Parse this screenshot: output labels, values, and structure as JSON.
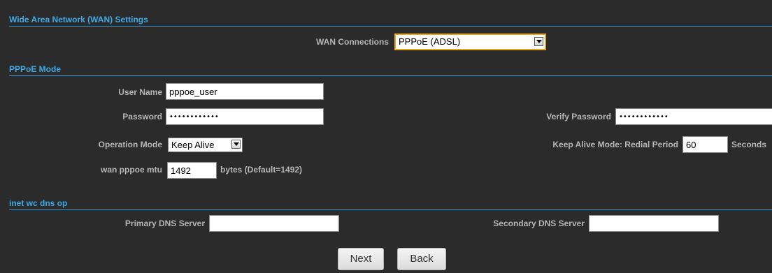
{
  "wan": {
    "title": "Wide Area Network (WAN) Settings",
    "connections_label": "WAN Connections",
    "connections_value": "PPPoE (ADSL)"
  },
  "pppoe": {
    "title": "PPPoE Mode",
    "username_label": "User Name",
    "username_value": "pppoe_user",
    "password_label": "Password",
    "password_value": "xxxxxxxxxxxx",
    "verify_label": "Verify Password",
    "verify_value": "xxxxxxxxxxxx",
    "opmode_label": "Operation Mode",
    "opmode_value": "Keep Alive",
    "redial_label": "Keep Alive Mode: Redial Period",
    "redial_value": "60",
    "redial_unit": "Seconds",
    "mtu_label": "wan pppoe mtu",
    "mtu_value": "1492",
    "mtu_hint": "bytes (Default=1492)"
  },
  "dns": {
    "title": "inet wc dns op",
    "primary_label": "Primary DNS Server",
    "primary_value": "",
    "secondary_label": "Secondary DNS Server",
    "secondary_value": ""
  },
  "buttons": {
    "next": "Next",
    "back": "Back"
  }
}
